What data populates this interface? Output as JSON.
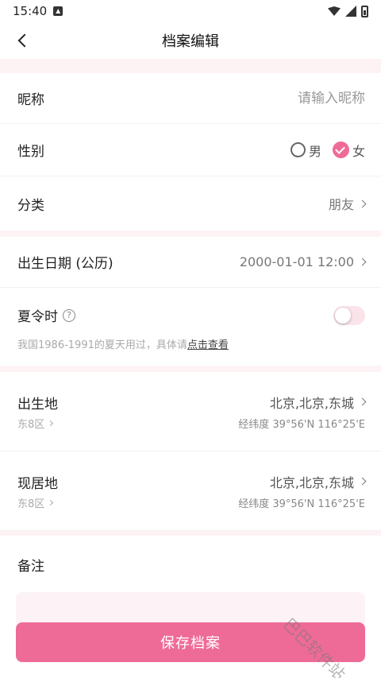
{
  "status_bar": {
    "time": "15:40"
  },
  "header": {
    "title": "档案编辑",
    "back_icon": "chevron-left-icon"
  },
  "form": {
    "nickname": {
      "label": "昵称",
      "placeholder": "请输入昵称",
      "value": ""
    },
    "gender": {
      "label": "性别",
      "options": [
        "男",
        "女"
      ],
      "selected": "女"
    },
    "category": {
      "label": "分类",
      "value": "朋友"
    },
    "birth_date": {
      "label": "出生日期 (公历)",
      "value": "2000-01-01 12:00"
    },
    "dst": {
      "label": "夏令时",
      "enabled": false,
      "note_prefix": "我国1986-1991的夏天用过，具体请",
      "note_link": "点击查看"
    },
    "birthplace": {
      "label": "出生地",
      "timezone": "东8区",
      "place": "北京,北京,东城",
      "coords": "经纬度 39°56'N 116°25'E"
    },
    "residence": {
      "label": "现居地",
      "timezone": "东8区",
      "place": "北京,北京,东城",
      "coords": "经纬度 39°56'N 116°25'E"
    },
    "remark": {
      "label": "备注",
      "value": ""
    }
  },
  "save_label": "保存档案",
  "watermark": "巴巴软件站",
  "colors": {
    "accent": "#ef6b97",
    "section_gap": "#fdf3f5"
  }
}
